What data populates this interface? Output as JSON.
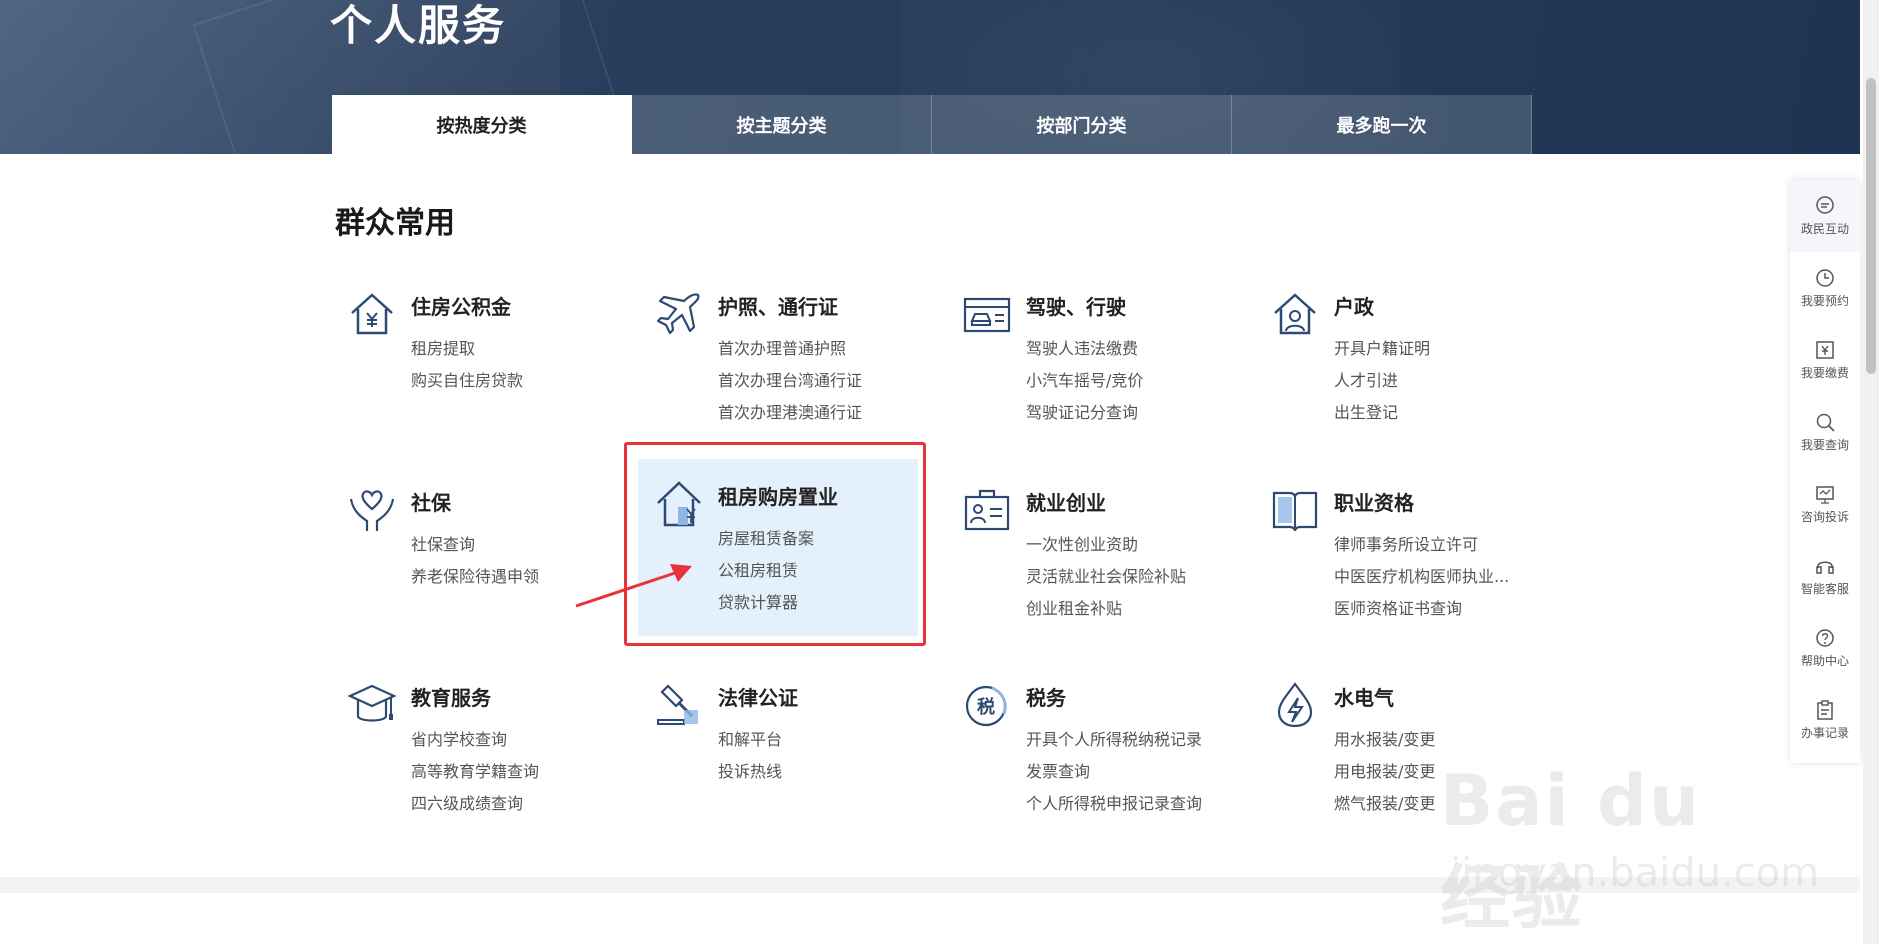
{
  "banner": {
    "title": "个人服务"
  },
  "tabs": [
    {
      "label": "按热度分类",
      "active": true
    },
    {
      "label": "按主题分类",
      "active": false
    },
    {
      "label": "按部门分类",
      "active": false
    },
    {
      "label": "最多跑一次",
      "active": false
    }
  ],
  "section": {
    "title": "群众常用"
  },
  "cards": [
    {
      "title": "住房公积金",
      "icon": "house-yuan-icon",
      "items": [
        "租房提取",
        "购买自住房贷款"
      ]
    },
    {
      "title": "护照、通行证",
      "icon": "airplane-icon",
      "items": [
        "首次办理普通护照",
        "首次办理台湾通行证",
        "首次办理港澳通行证"
      ]
    },
    {
      "title": "驾驶、行驶",
      "icon": "vehicle-license-icon",
      "items": [
        "驾驶人违法缴费",
        "小汽车摇号/竞价",
        "驾驶证记分查询"
      ]
    },
    {
      "title": "户政",
      "icon": "house-person-icon",
      "items": [
        "开具户籍证明",
        "人才引进",
        "出生登记"
      ]
    },
    {
      "title": "社保",
      "icon": "heart-hands-icon",
      "items": [
        "社保查询",
        "养老保险待遇申领"
      ]
    },
    {
      "title": "租房购房置业",
      "icon": "house-arrow-yuan-icon",
      "items": [
        "房屋租赁备案",
        "公租房租赁",
        "贷款计算器"
      ]
    },
    {
      "title": "就业创业",
      "icon": "briefcase-id-icon",
      "items": [
        "一次性创业资助",
        "灵活就业社会保险补贴",
        "创业租金补贴"
      ]
    },
    {
      "title": "职业资格",
      "icon": "open-book-icon",
      "items": [
        "律师事务所设立许可",
        "中医医疗机构医师执业...",
        "医师资格证书查询"
      ]
    },
    {
      "title": "教育服务",
      "icon": "graduation-cap-icon",
      "items": [
        "省内学校查询",
        "高等教育学籍查询",
        "四六级成绩查询"
      ]
    },
    {
      "title": "法律公证",
      "icon": "gavel-icon",
      "items": [
        "和解平台",
        "投诉热线"
      ]
    },
    {
      "title": "税务",
      "icon": "tax-seal-icon",
      "items": [
        "开具个人所得税纳税记录",
        "发票查询",
        "个人所得税申报记录查询"
      ]
    },
    {
      "title": "水电气",
      "icon": "water-lightning-icon",
      "items": [
        "用水报装/变更",
        "用电报装/变更",
        "燃气报装/变更"
      ]
    }
  ],
  "float_bar": [
    {
      "label": "政民互动",
      "icon": "chat-bubble-icon"
    },
    {
      "label": "我要预约",
      "icon": "clock-icon"
    },
    {
      "label": "我要缴费",
      "icon": "yuan-payment-icon"
    },
    {
      "label": "我要查询",
      "icon": "search-icon"
    },
    {
      "label": "咨询投诉",
      "icon": "monitor-icon"
    },
    {
      "label": "智能客服",
      "icon": "headset-icon"
    },
    {
      "label": "帮助中心",
      "icon": "help-icon"
    },
    {
      "label": "办事记录",
      "icon": "clipboard-icon"
    }
  ],
  "watermark": {
    "logo": "Bai du 经验",
    "url": "jingyan.baidu.com"
  },
  "colors": {
    "banner": "#233a58",
    "highlight": "#e4f0fc",
    "annotation": "#e8333a",
    "icon_blue": "#2c4a72"
  }
}
